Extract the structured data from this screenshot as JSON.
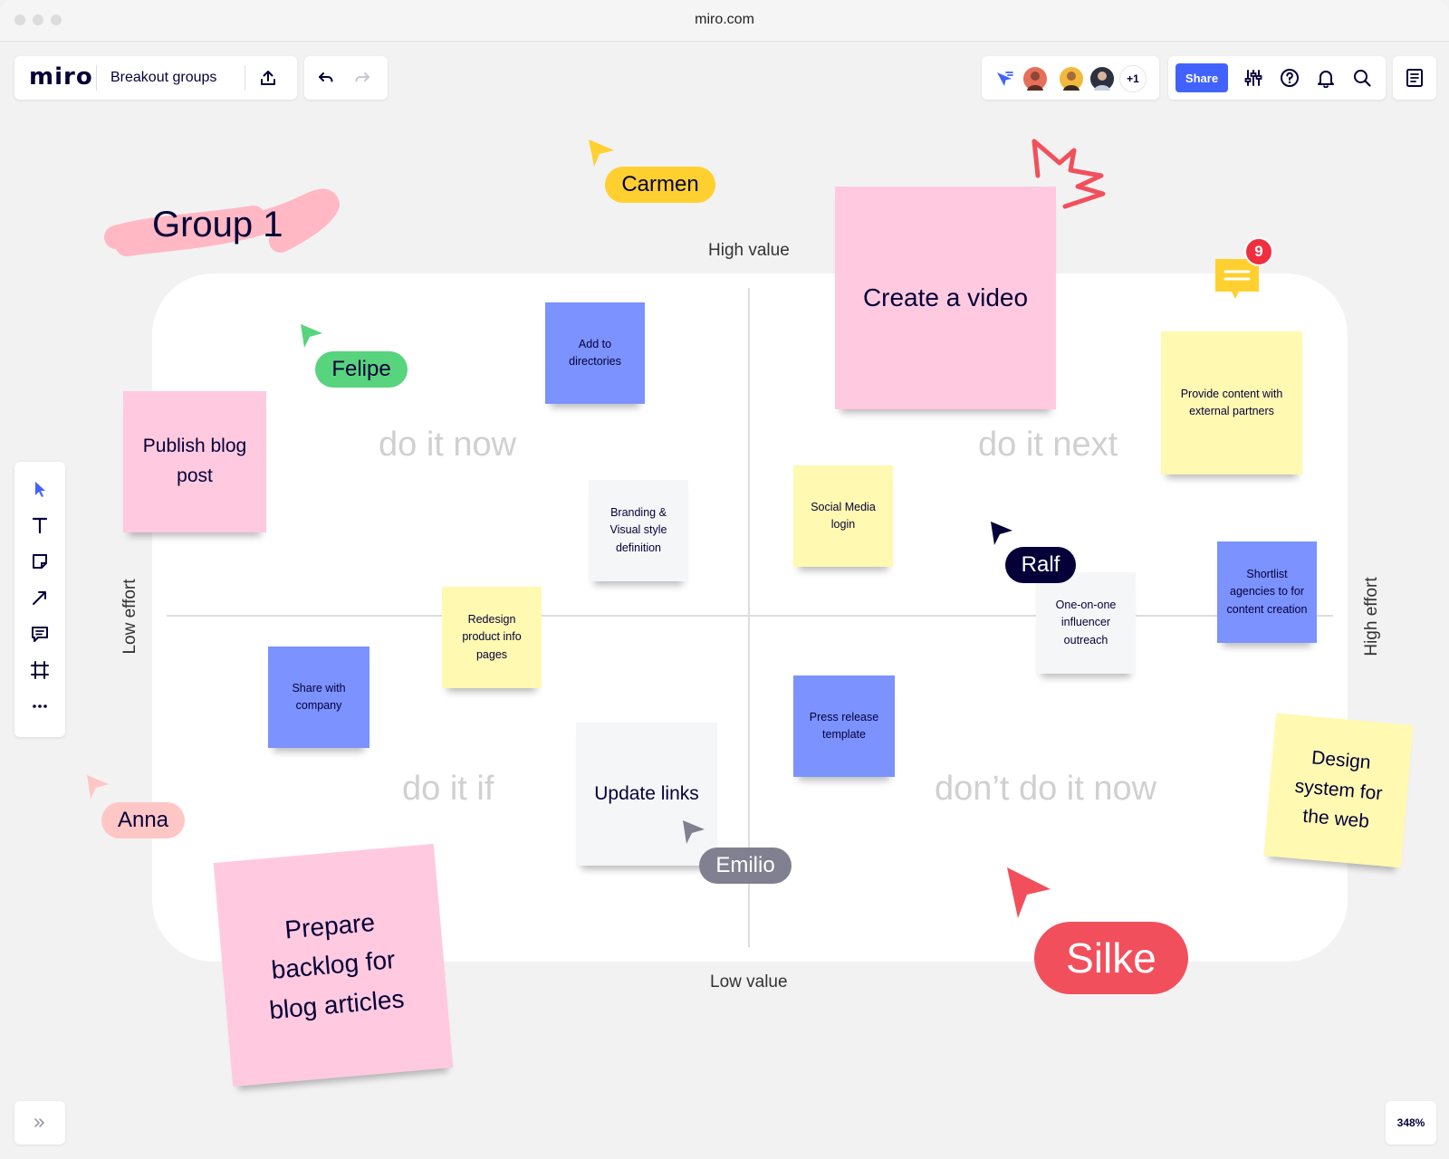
{
  "window": {
    "url": "miro.com"
  },
  "header": {
    "logo": "miro",
    "board_name": "Breakout groups",
    "share_label": "Share",
    "collaborators_more": "+1"
  },
  "canvas": {
    "group_title": "Group 1",
    "axis": {
      "top": "High value",
      "bottom": "Low value",
      "left": "Low effort",
      "right": "High effort"
    },
    "quadrants": {
      "top_left": "do it now",
      "top_right": "do it next",
      "bottom_left": "do it if",
      "bottom_right": "don’t do it now"
    },
    "stickies": {
      "add_directories": "Add to directories",
      "create_video": "Create a video",
      "provide_content": "Provide content with external partners",
      "publish_blog": "Publish blog post",
      "branding": "Branding & Visual style definition",
      "social_media": "Social Media login",
      "shortlist": "Shortlist agencies to for content creation",
      "one_on_one": "One-on-one influencer outreach",
      "redesign": "Redesign product info pages",
      "share_company": "Share with company",
      "press_release": "Press release template",
      "update_links": "Update links",
      "design_system": "Design system for the web",
      "prepare_backlog": "Prepare backlog for blog articles"
    },
    "comment_count": "9"
  },
  "cursors": {
    "carmen": {
      "name": "Carmen",
      "color": "#ffd02f"
    },
    "felipe": {
      "name": "Felipe",
      "color": "#58d37e"
    },
    "ralf": {
      "name": "Ralf",
      "color": "#050038"
    },
    "anna": {
      "name": "Anna",
      "color": "#ffc6c6"
    },
    "emilio": {
      "name": "Emilio",
      "color": "#808090"
    },
    "silke": {
      "name": "Silke",
      "color": "#f24f5c"
    }
  },
  "footer": {
    "zoom": "348%"
  },
  "colors": {
    "accent": "#4262ff",
    "sticky_pink": "#ffcadf",
    "sticky_yellow": "#fff9b1",
    "sticky_blue": "#7b92ff"
  }
}
